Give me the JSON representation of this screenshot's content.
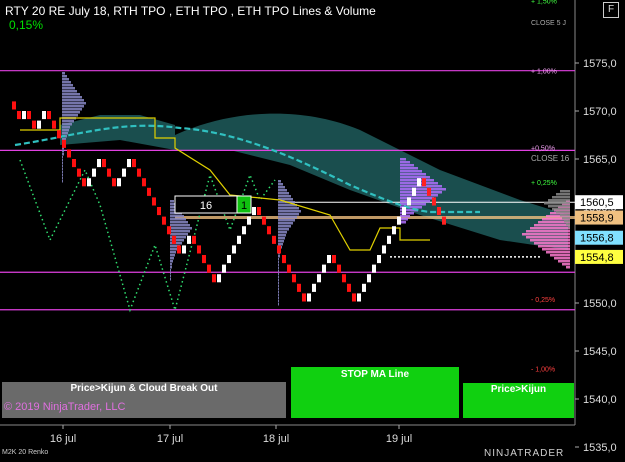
{
  "header": {
    "title": "RTY 20 RE July 18, RTH TPO , ETH TPO , ETH TPO Lines & Volume",
    "change": "0,15%",
    "logo_letter": "F"
  },
  "footer": {
    "copyright": "© 2019 NinjaTrader, LLC",
    "chart_type": "M2K 20 Renko",
    "brand": "NINJATRADER"
  },
  "signals": {
    "left": "Price>Kijun & Cloud Break Out",
    "middle": "STOP MA Line",
    "right": "Price>Kijun",
    "box_value": "16",
    "box_marker": "1"
  },
  "chart_data": {
    "type": "line",
    "xlabels": [
      "16 jul",
      "17 jul",
      "18 jul",
      "19 jul"
    ],
    "ylim": [
      1534,
      1580
    ],
    "yticks": [
      "1575,0",
      "1570,0",
      "1565,0",
      "1560,0",
      "1555,0",
      "1550,0",
      "1545,0",
      "1540,0",
      "1535,0"
    ],
    "ytick_values": [
      1575,
      1570,
      1565,
      1560,
      1555,
      1550,
      1545,
      1540,
      1535
    ],
    "price_tags": [
      {
        "label": "1560,5",
        "value": 1560.5,
        "color": "#ffffff"
      },
      {
        "label": "1558,9",
        "value": 1558.9,
        "color": "#f0c080"
      },
      {
        "label": "1556,8",
        "value": 1556.8,
        "color": "#80e0ff"
      },
      {
        "label": "1554,8",
        "value": 1554.8,
        "color": "#ffff40"
      }
    ],
    "pct_labels": [
      {
        "label": "+ 1,50%",
        "value": 1581.5,
        "color": "#40ff40"
      },
      {
        "label": "+ 1,00%",
        "value": 1574.2,
        "color": "#f0a0f0"
      },
      {
        "label": "+0,50%",
        "value": 1566.2,
        "color": "#f0a0f0"
      },
      {
        "label": "+ 0,25%",
        "value": 1562.6,
        "color": "#40ff40"
      },
      {
        "label": "- 0,25%",
        "value": 1550.4,
        "color": "#ff4040"
      },
      {
        "label": "- 1,00%",
        "value": 1543.2,
        "color": "#ff4040"
      }
    ],
    "annotations": [
      "CLOSE 5 J",
      "CLOSE 16"
    ],
    "hlines": [
      {
        "value": 1574.2,
        "color": "#e040e0"
      },
      {
        "value": 1565.9,
        "color": "#e040e0"
      },
      {
        "value": 1553.2,
        "color": "#e040e0"
      },
      {
        "value": 1549.3,
        "color": "#e040e0"
      }
    ],
    "renko_close": [
      1570,
      1569,
      1570,
      1569,
      1568,
      1569,
      1570,
      1569,
      1568,
      1567,
      1566,
      1565,
      1564,
      1563,
      1562,
      1563,
      1564,
      1565,
      1564,
      1563,
      1562,
      1563,
      1564,
      1565,
      1564,
      1563,
      1562,
      1561,
      1560,
      1559,
      1558,
      1557,
      1556,
      1555,
      1556,
      1557,
      1556,
      1555,
      1554,
      1553,
      1552,
      1553,
      1554,
      1555,
      1556,
      1557,
      1558,
      1559,
      1560,
      1559,
      1558,
      1557,
      1556,
      1555,
      1554,
      1553,
      1552,
      1551,
      1550,
      1551,
      1552,
      1553,
      1554,
      1555,
      1554,
      1553,
      1552,
      1551,
      1550,
      1551,
      1552,
      1553,
      1554,
      1555,
      1556,
      1557,
      1558,
      1559,
      1560,
      1561,
      1562,
      1563,
      1562,
      1561,
      1560,
      1559,
      1558
    ]
  }
}
